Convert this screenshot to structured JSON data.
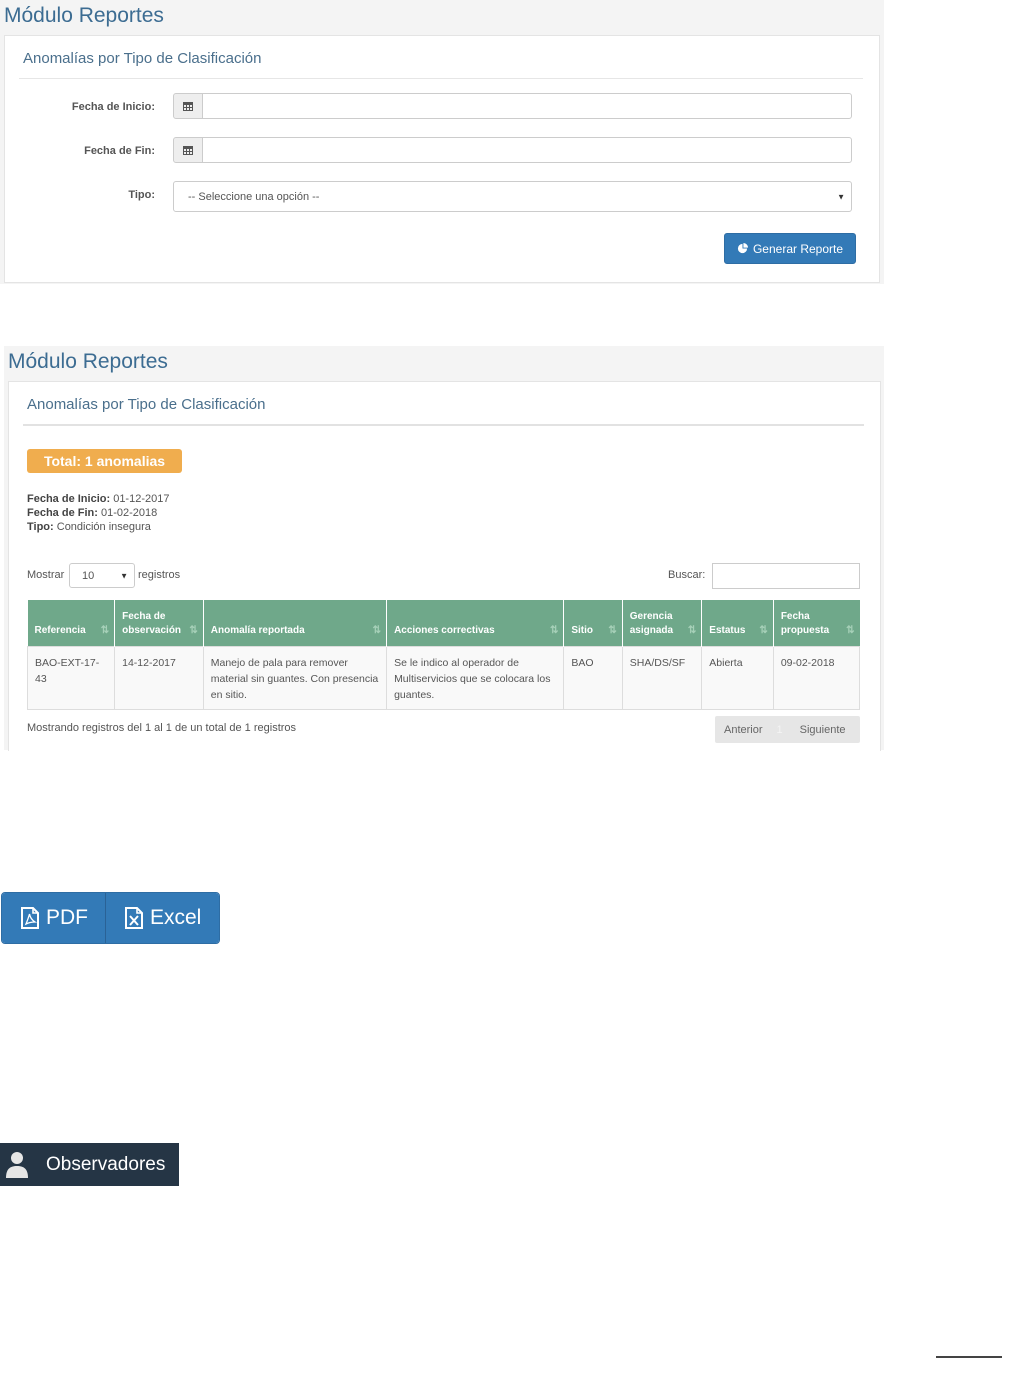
{
  "screen1": {
    "module_title": "Módulo Reportes",
    "panel_title": "Anomalías por Tipo de Clasificación",
    "form": {
      "start_label": "Fecha de Inicio:",
      "end_label": "Fecha de Fin:",
      "type_label": "Tipo:",
      "type_select": "-- Seleccione una opción --",
      "start_value": "",
      "end_value": ""
    },
    "generate_button": "Generar Reporte"
  },
  "screen2": {
    "module_title": "Módulo Reportes",
    "panel_title": "Anomalías por Tipo de Clasificación",
    "total_badge": "Total: 1 anomalias",
    "summary": {
      "start_label": "Fecha de Inicio:",
      "start_value": " 01-12-2017",
      "end_label": "Fecha de Fin:",
      "end_value": " 01-02-2018",
      "type_label": "Tipo:",
      "type_value": " Condición insegura"
    },
    "show_label": "Mostrar",
    "page_size": "10",
    "records_label": "registros",
    "search_label": "Buscar:",
    "search_value": "",
    "columns": [
      "Referencia",
      "Fecha de observación",
      "Anomalía reportada",
      "Acciones correctivas",
      "Sitio",
      "Gerencia asignada",
      "Estatus",
      "Fecha propuesta"
    ],
    "rows": [
      [
        "BAO-EXT-17-43",
        "14-12-2017",
        "Manejo de pala para remover material sin guantes. Con presencia en sitio.",
        "Se le indico al operador de Multiservicios que se colocara los guantes.",
        "BAO",
        "SHA/DS/SF",
        "Abierta",
        "09-02-2018"
      ]
    ],
    "info": "Mostrando registros del 1 al 1 de un total de 1 registros",
    "pager": {
      "prev": "Anterior",
      "page": "1",
      "next": "Siguiente"
    }
  },
  "export": {
    "pdf": "PDF",
    "excel": "Excel"
  },
  "observers": {
    "label": "Observadores"
  },
  "colors": {
    "primary": "#337ab7",
    "table_header": "#6fa88a",
    "badge": "#f0ad4e",
    "nav_dark": "#253545"
  },
  "icons": [
    "calendar-icon",
    "pie-chart-icon",
    "sort-icon",
    "file-pdf-icon",
    "file-excel-icon",
    "user-icon"
  ]
}
